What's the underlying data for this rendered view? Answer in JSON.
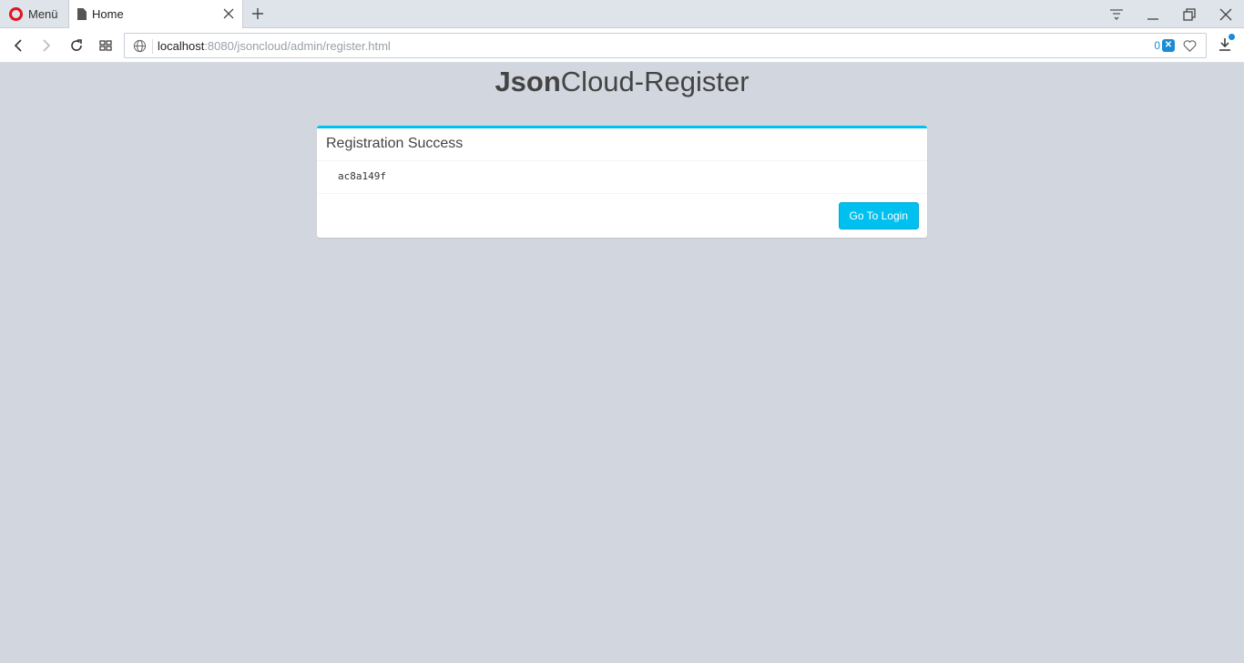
{
  "browser": {
    "menu_label": "Menü",
    "tab_title": "Home",
    "url_host": "localhost",
    "url_rest": ":8080/jsoncloud/admin/register.html",
    "adblock_count": "0",
    "accent_color": "#1a8bd6"
  },
  "page": {
    "logo_bold": "Json",
    "logo_light": "Cloud-Register",
    "box_title": "Registration Success",
    "box_body": "ac8a149f",
    "login_button": "Go To Login",
    "box_border_color": "#00c0ef"
  }
}
